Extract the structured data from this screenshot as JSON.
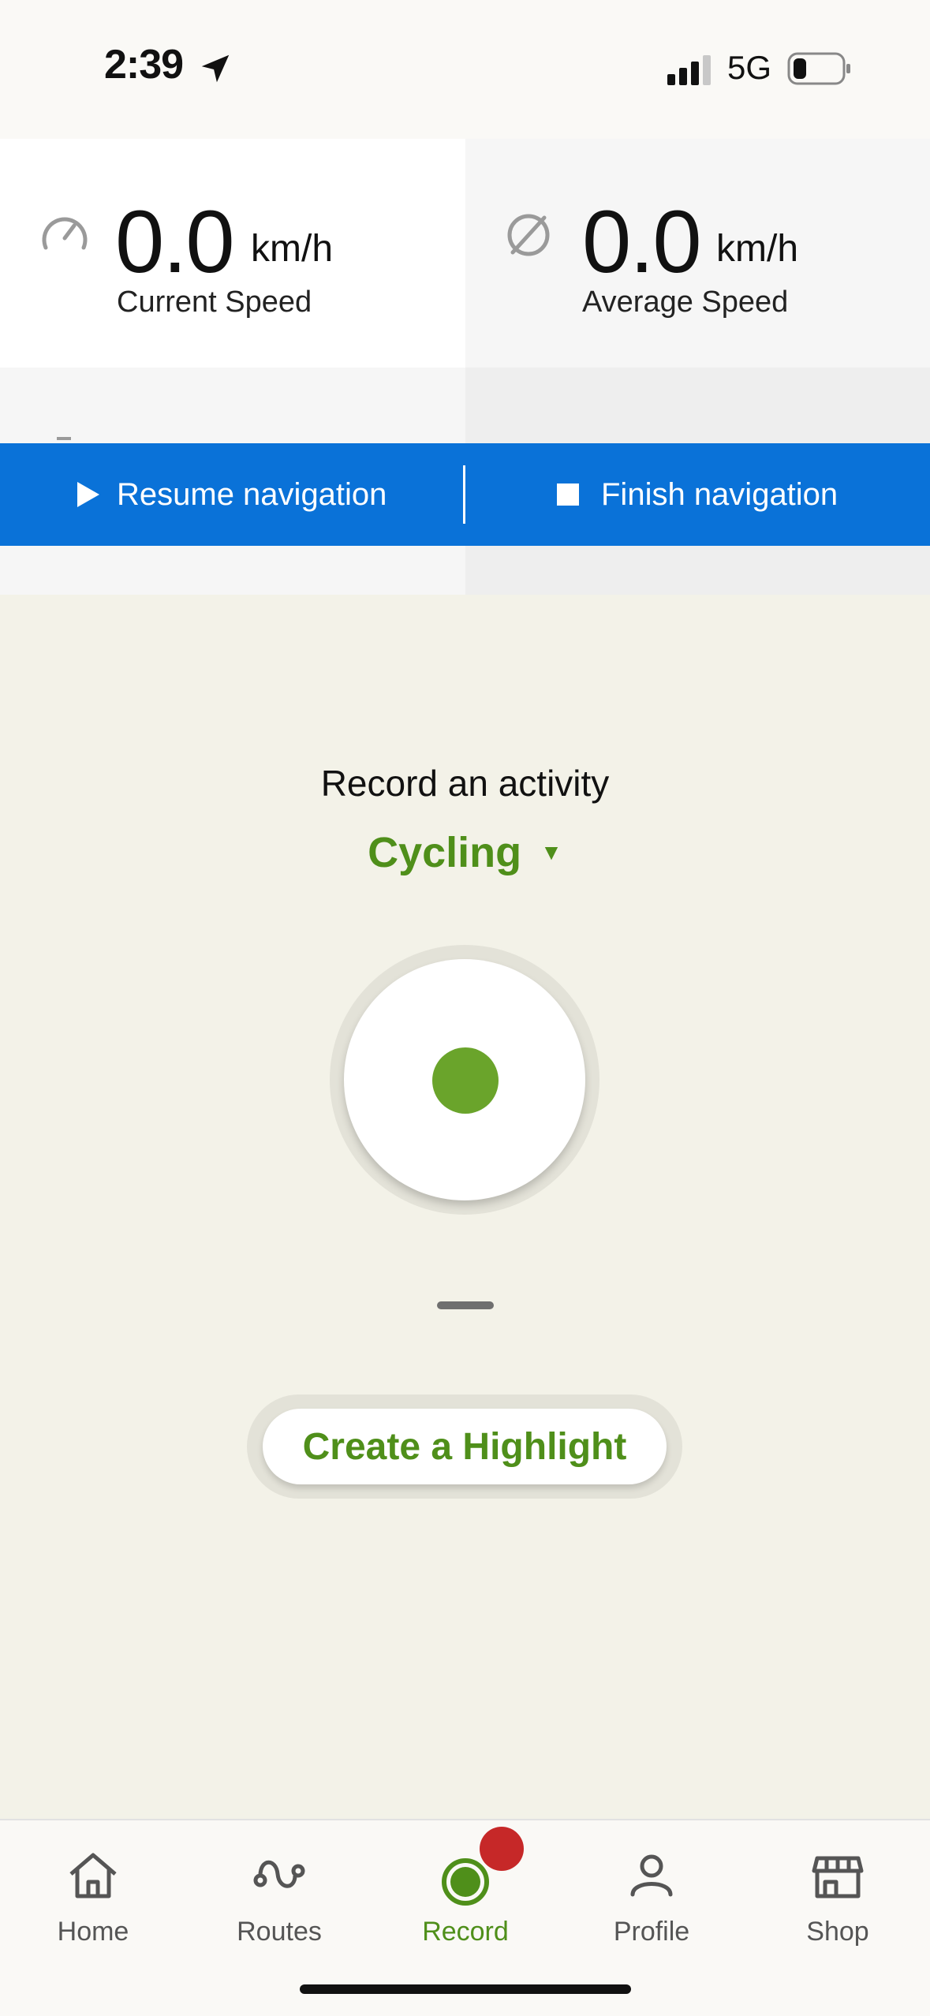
{
  "status_bar": {
    "time": "2:39",
    "network": "5G",
    "icons": [
      "location-arrow-icon",
      "signal-icon",
      "battery-icon"
    ]
  },
  "speed": {
    "current": {
      "value": "0.0",
      "unit": "km/h",
      "label": "Current Speed",
      "icon": "speedometer-icon"
    },
    "average": {
      "value": "0.0",
      "unit": "km/h",
      "label": "Average Speed",
      "icon": "average-icon"
    }
  },
  "navigation": {
    "resume_label": "Resume navigation",
    "finish_label": "Finish navigation",
    "background": "#0a72d8"
  },
  "record": {
    "heading": "Record an activity",
    "activity": "Cycling",
    "caret": "▼",
    "accent": "#4f8f1a",
    "record_dot_color": "#6aa42b"
  },
  "highlight": {
    "label": "Create a Highlight"
  },
  "tab_bar": {
    "active": "Record",
    "tabs": [
      {
        "label": "Home",
        "icon": "home-icon"
      },
      {
        "label": "Routes",
        "icon": "routes-icon"
      },
      {
        "label": "Record",
        "icon": "record-icon"
      },
      {
        "label": "Profile",
        "icon": "profile-icon"
      },
      {
        "label": "Shop",
        "icon": "shop-icon"
      }
    ],
    "badge_color": "#c62828"
  }
}
